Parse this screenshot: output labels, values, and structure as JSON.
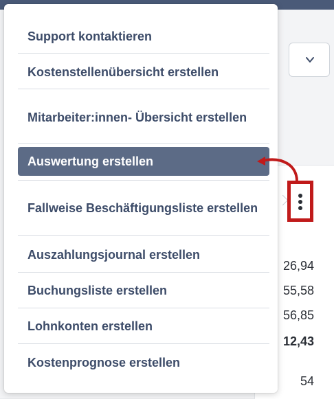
{
  "menu": {
    "items": [
      {
        "label": "Support kontaktieren",
        "active": false
      },
      {
        "label": "Kostenstellenübersicht erstellen",
        "active": false
      },
      {
        "label": "Mitarbeiter:innen- Übersicht erstellen",
        "active": false
      },
      {
        "label": "Auswertung erstellen",
        "active": true
      },
      {
        "label": "Fallweise Beschäftigungsliste erstellen",
        "active": false
      },
      {
        "label": "Auszahlungsjournal erstellen",
        "active": false
      },
      {
        "label": "Buchungsliste erstellen",
        "active": false
      },
      {
        "label": "Lohnkonten erstellen",
        "active": false
      },
      {
        "label": "Kostenprognose erstellen",
        "active": false
      }
    ]
  },
  "background": {
    "values": [
      "26,94",
      "55,58",
      "56,85",
      "12,43",
      "54"
    ],
    "highlight_color": "#c01a1a",
    "select_icon": "chevron-down-icon",
    "kebab_icon": "more-vertical-icon"
  }
}
